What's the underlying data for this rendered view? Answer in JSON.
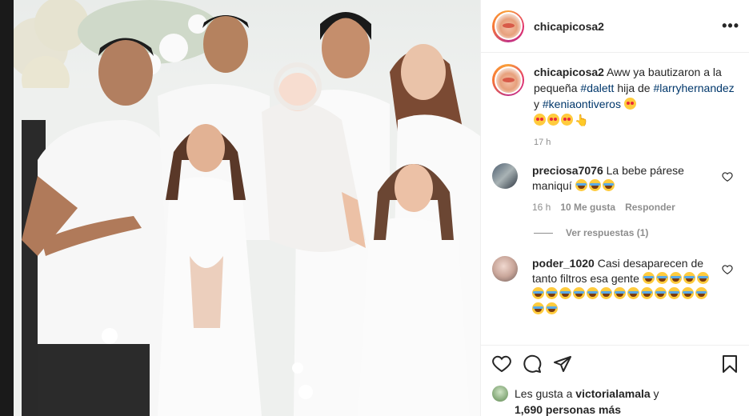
{
  "post": {
    "username": "chicapicosa2",
    "more_label": "•••",
    "caption": {
      "username": "chicapicosa2",
      "text1": " Aww ya bautizaron a la pequeña ",
      "tag1": "#dalett",
      "text2": " hija de ",
      "tag2": "#larryhernandez",
      "text3": " y ",
      "tag3": "#keniaontiveros",
      "emojis": [
        "heart-eyes-icon",
        "heart-eyes-icon",
        "heart-eyes-icon",
        "heart-eyes-icon",
        "waving-hand-icon"
      ],
      "time": "17 h"
    },
    "comments": [
      {
        "username": "preciosa7076",
        "text": " La bebe párese maniquí ",
        "emoji_count": 3,
        "time": "16 h",
        "likes": "10 Me gusta",
        "reply": "Responder",
        "view_replies": "Ver respuestas (1)"
      },
      {
        "username": "poder_1020",
        "text": " Casi desaparecen de tanto filtros esa gente ",
        "emoji_count": 20
      }
    ],
    "likes": {
      "prefix": "Les gusta a ",
      "user": "victorialamala",
      "suffix": " y",
      "count": "1,690 personas más"
    },
    "colors": {
      "link": "#00376b",
      "muted": "#8e8e8e",
      "text": "#262626",
      "border": "#efefef"
    }
  }
}
